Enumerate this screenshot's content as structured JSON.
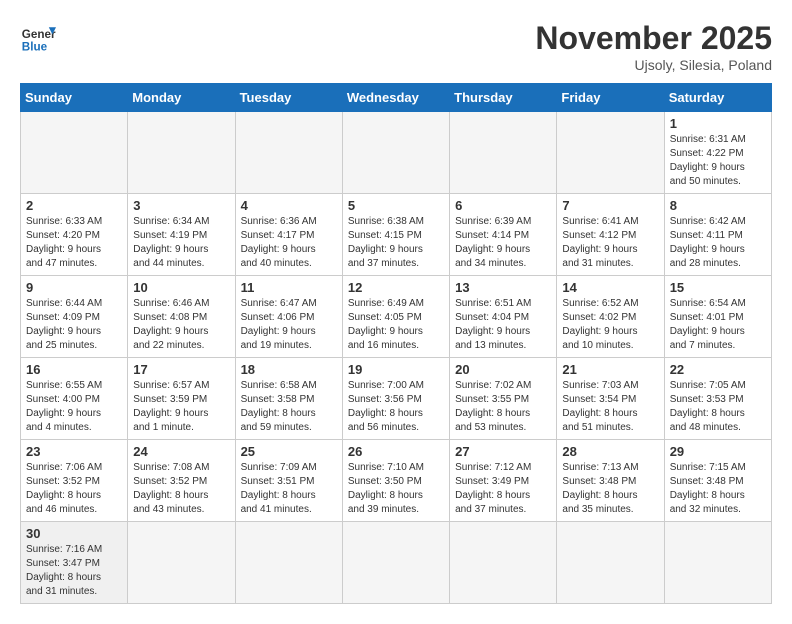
{
  "logo": {
    "line1": "General",
    "line2": "Blue"
  },
  "title": "November 2025",
  "location": "Ujsoly, Silesia, Poland",
  "weekdays": [
    "Sunday",
    "Monday",
    "Tuesday",
    "Wednesday",
    "Thursday",
    "Friday",
    "Saturday"
  ],
  "weeks": [
    [
      {
        "day": "",
        "info": ""
      },
      {
        "day": "",
        "info": ""
      },
      {
        "day": "",
        "info": ""
      },
      {
        "day": "",
        "info": ""
      },
      {
        "day": "",
        "info": ""
      },
      {
        "day": "",
        "info": ""
      },
      {
        "day": "1",
        "info": "Sunrise: 6:31 AM\nSunset: 4:22 PM\nDaylight: 9 hours\nand 50 minutes."
      }
    ],
    [
      {
        "day": "2",
        "info": "Sunrise: 6:33 AM\nSunset: 4:20 PM\nDaylight: 9 hours\nand 47 minutes."
      },
      {
        "day": "3",
        "info": "Sunrise: 6:34 AM\nSunset: 4:19 PM\nDaylight: 9 hours\nand 44 minutes."
      },
      {
        "day": "4",
        "info": "Sunrise: 6:36 AM\nSunset: 4:17 PM\nDaylight: 9 hours\nand 40 minutes."
      },
      {
        "day": "5",
        "info": "Sunrise: 6:38 AM\nSunset: 4:15 PM\nDaylight: 9 hours\nand 37 minutes."
      },
      {
        "day": "6",
        "info": "Sunrise: 6:39 AM\nSunset: 4:14 PM\nDaylight: 9 hours\nand 34 minutes."
      },
      {
        "day": "7",
        "info": "Sunrise: 6:41 AM\nSunset: 4:12 PM\nDaylight: 9 hours\nand 31 minutes."
      },
      {
        "day": "8",
        "info": "Sunrise: 6:42 AM\nSunset: 4:11 PM\nDaylight: 9 hours\nand 28 minutes."
      }
    ],
    [
      {
        "day": "9",
        "info": "Sunrise: 6:44 AM\nSunset: 4:09 PM\nDaylight: 9 hours\nand 25 minutes."
      },
      {
        "day": "10",
        "info": "Sunrise: 6:46 AM\nSunset: 4:08 PM\nDaylight: 9 hours\nand 22 minutes."
      },
      {
        "day": "11",
        "info": "Sunrise: 6:47 AM\nSunset: 4:06 PM\nDaylight: 9 hours\nand 19 minutes."
      },
      {
        "day": "12",
        "info": "Sunrise: 6:49 AM\nSunset: 4:05 PM\nDaylight: 9 hours\nand 16 minutes."
      },
      {
        "day": "13",
        "info": "Sunrise: 6:51 AM\nSunset: 4:04 PM\nDaylight: 9 hours\nand 13 minutes."
      },
      {
        "day": "14",
        "info": "Sunrise: 6:52 AM\nSunset: 4:02 PM\nDaylight: 9 hours\nand 10 minutes."
      },
      {
        "day": "15",
        "info": "Sunrise: 6:54 AM\nSunset: 4:01 PM\nDaylight: 9 hours\nand 7 minutes."
      }
    ],
    [
      {
        "day": "16",
        "info": "Sunrise: 6:55 AM\nSunset: 4:00 PM\nDaylight: 9 hours\nand 4 minutes."
      },
      {
        "day": "17",
        "info": "Sunrise: 6:57 AM\nSunset: 3:59 PM\nDaylight: 9 hours\nand 1 minute."
      },
      {
        "day": "18",
        "info": "Sunrise: 6:58 AM\nSunset: 3:58 PM\nDaylight: 8 hours\nand 59 minutes."
      },
      {
        "day": "19",
        "info": "Sunrise: 7:00 AM\nSunset: 3:56 PM\nDaylight: 8 hours\nand 56 minutes."
      },
      {
        "day": "20",
        "info": "Sunrise: 7:02 AM\nSunset: 3:55 PM\nDaylight: 8 hours\nand 53 minutes."
      },
      {
        "day": "21",
        "info": "Sunrise: 7:03 AM\nSunset: 3:54 PM\nDaylight: 8 hours\nand 51 minutes."
      },
      {
        "day": "22",
        "info": "Sunrise: 7:05 AM\nSunset: 3:53 PM\nDaylight: 8 hours\nand 48 minutes."
      }
    ],
    [
      {
        "day": "23",
        "info": "Sunrise: 7:06 AM\nSunset: 3:52 PM\nDaylight: 8 hours\nand 46 minutes."
      },
      {
        "day": "24",
        "info": "Sunrise: 7:08 AM\nSunset: 3:52 PM\nDaylight: 8 hours\nand 43 minutes."
      },
      {
        "day": "25",
        "info": "Sunrise: 7:09 AM\nSunset: 3:51 PM\nDaylight: 8 hours\nand 41 minutes."
      },
      {
        "day": "26",
        "info": "Sunrise: 7:10 AM\nSunset: 3:50 PM\nDaylight: 8 hours\nand 39 minutes."
      },
      {
        "day": "27",
        "info": "Sunrise: 7:12 AM\nSunset: 3:49 PM\nDaylight: 8 hours\nand 37 minutes."
      },
      {
        "day": "28",
        "info": "Sunrise: 7:13 AM\nSunset: 3:48 PM\nDaylight: 8 hours\nand 35 minutes."
      },
      {
        "day": "29",
        "info": "Sunrise: 7:15 AM\nSunset: 3:48 PM\nDaylight: 8 hours\nand 32 minutes."
      }
    ],
    [
      {
        "day": "30",
        "info": "Sunrise: 7:16 AM\nSunset: 3:47 PM\nDaylight: 8 hours\nand 31 minutes."
      },
      {
        "day": "",
        "info": ""
      },
      {
        "day": "",
        "info": ""
      },
      {
        "day": "",
        "info": ""
      },
      {
        "day": "",
        "info": ""
      },
      {
        "day": "",
        "info": ""
      },
      {
        "day": "",
        "info": ""
      }
    ]
  ]
}
